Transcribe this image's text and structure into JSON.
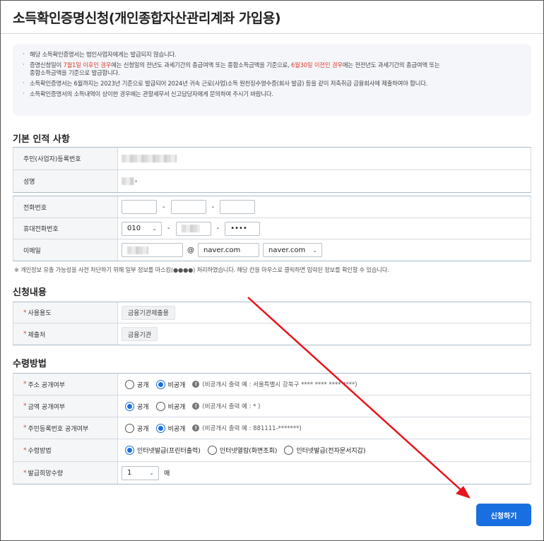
{
  "page": {
    "title": "소득확인증명신청(개인종합자산관리계좌 가입용)"
  },
  "notice": {
    "line1": "해당 소득확인증명서는 법인사업자에게는 발급되지 않습니다.",
    "line2_a": "증명신청일이 ",
    "line2_red1": "7월1일 이후인 경우",
    "line2_b": "에는 신청일의 전년도 과세기간의 총급여액 또는 종합소득금액을 기준으로, ",
    "line2_red2": "6월30일 이전인 경우",
    "line2_c": "에는 전전년도 과세기간의 총급여액 또는",
    "line2_d": "종합소득금액을 기준으로 발급합니다.",
    "line3": "소득확인증명서는 6월까지는 2023년 기준으로 발급되어 2024년 귀속 근로(사업)소득 원천징수영수증(회사 발급) 등을 같이 저축취급 금융회사에 제출하여야 합니다.",
    "line4": "소득확인증명서의 소득내역이 상이한 경우에는 관할세무서 신고담당자에게 문의하여 주시기 바랍니다."
  },
  "basic": {
    "section_title": "기본 인적 사항",
    "id_label": "주민(사업자)등록번호",
    "name_label": "성명",
    "name_suffix": "›",
    "phone_label": "전화번호",
    "mobile_label": "휴대전화번호",
    "mobile_prefix": "010",
    "mobile_last": "••••",
    "email_label": "이메일",
    "email_at": "@",
    "email_domain": "naver.com",
    "email_domain_select": "naver.com",
    "dash": "-",
    "privacy_note": "※ 개인정보 유출 가능성을 사전 차단하기 위해 일부 정보를 마스킹(●●●●) 처리하였습니다. 해당 칸을 마우스로 클릭하면 입력된 정보를 확인할 수 있습니다."
  },
  "request": {
    "section_title": "신청내용",
    "use_label": "사용용도",
    "use_value": "금융기관제출용",
    "submit_to_label": "제출처",
    "submit_to_value": "금융기관"
  },
  "receipt": {
    "section_title": "수령방법",
    "address_label": "주소 공개여부",
    "amount_label": "금액 공개여부",
    "rrn_label": "주민등록번호 공개여부",
    "method_label": "수령방법",
    "copies_label": "발급희망수량",
    "public": "공개",
    "private": "비공개",
    "address_hint": "(비공개시 출력 예 : 서울특별시 강북구 **** **** **** ****)",
    "amount_hint": "(비공개시 출력 예 : * )",
    "rrn_hint": "(비공개시 출력 예 : 881111-*******)",
    "method_print": "인터넷발급(프린터출력)",
    "method_view": "인터넷열람(화면조회)",
    "method_doc": "인터넷발급(전자문서지갑)",
    "copies_value": "1",
    "copies_unit": "매",
    "address_choice": "비공개",
    "amount_choice": "공개",
    "rrn_choice": "비공개",
    "method_choice": "인터넷발급(프린터출력)"
  },
  "actions": {
    "submit_label": "신청하기"
  },
  "colors": {
    "accent": "#1a6fe0",
    "required": "#e0392b",
    "annotation_arrow": "#e8141b"
  }
}
